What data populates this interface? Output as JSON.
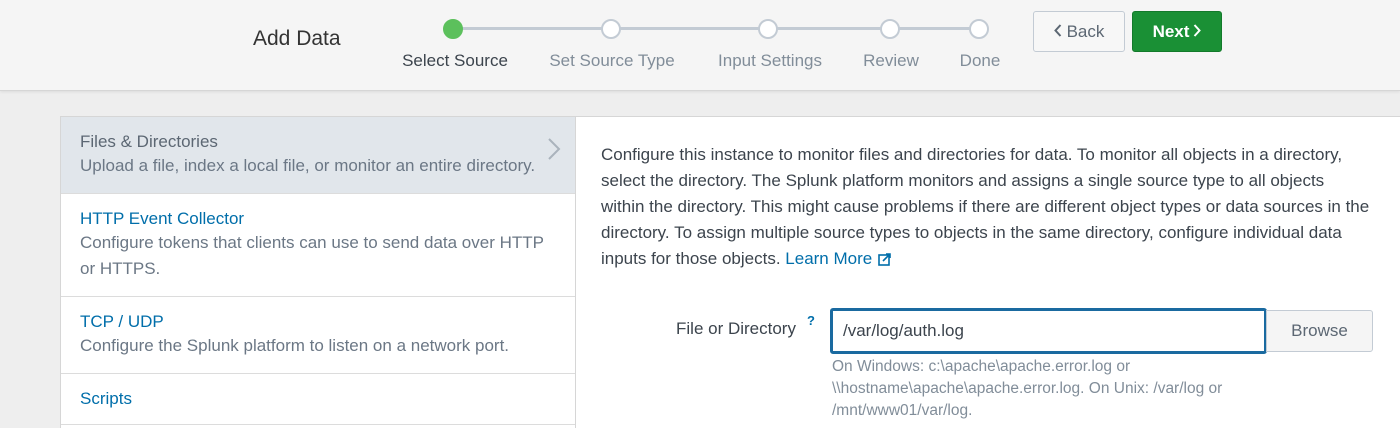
{
  "header": {
    "title": "Add Data",
    "back_label": "Back",
    "next_label": "Next"
  },
  "wizard": {
    "steps": [
      {
        "label": "Select Source",
        "state": "active"
      },
      {
        "label": "Set Source Type",
        "state": "pending"
      },
      {
        "label": "Input Settings",
        "state": "pending"
      },
      {
        "label": "Review",
        "state": "pending"
      },
      {
        "label": "Done",
        "state": "pending"
      }
    ]
  },
  "sources": [
    {
      "name": "Files & Directories",
      "description": "Upload a file, index a local file, or monitor an entire directory."
    },
    {
      "name": "HTTP Event Collector",
      "description": "Configure tokens that clients can use to send data over HTTP or HTTPS."
    },
    {
      "name": "TCP / UDP",
      "description": "Configure the Splunk platform to listen on a network port."
    },
    {
      "name": "Scripts",
      "description": ""
    }
  ],
  "detail": {
    "description": "Configure this instance to monitor files and directories for data. To monitor all objects in a directory, select the directory. The Splunk platform monitors and assigns a single source type to all objects within the directory. This might cause problems if there are different object types or data sources in the directory. To assign multiple source types to objects in the same directory, configure individual data inputs for those objects.",
    "learn_more": "Learn More",
    "field_label": "File or Directory",
    "help_marker": "?",
    "field_value": "/var/log/auth.log",
    "browse_label": "Browse",
    "field_help": "On Windows: c:\\apache\\apache.error.log or \\\\hostname\\apache\\apache.error.log. On Unix: /var/log or /mnt/www01/var/log."
  },
  "colors": {
    "accent_green": "#1a9035",
    "active_step": "#5cc05c",
    "link_blue": "#006eaa",
    "input_border": "#1a6aa0"
  }
}
